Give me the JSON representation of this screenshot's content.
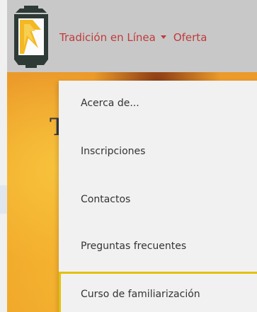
{
  "header": {
    "logo_icon": "lantern-logo-icon",
    "nav": [
      {
        "label": "Tradición en Línea",
        "has_dropdown": true
      },
      {
        "label": "Oferta"
      }
    ],
    "nav_color": "#c23a3a"
  },
  "hero": {
    "title_fragment": "T"
  },
  "dropdown": {
    "items": [
      {
        "label": "Acerca de..."
      },
      {
        "label": "Inscripciones"
      },
      {
        "label": "Contactos"
      },
      {
        "label": "Preguntas frecuentes"
      },
      {
        "label": "Curso de familiarización",
        "focused": true
      }
    ],
    "focus_color": "#e3c10a"
  }
}
